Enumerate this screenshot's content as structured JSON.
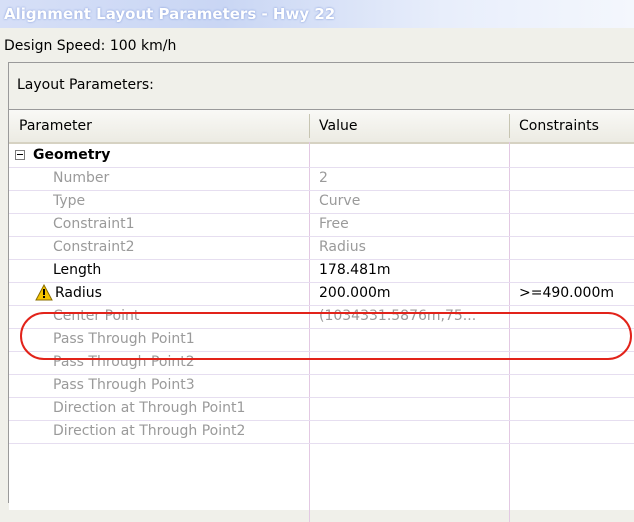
{
  "window": {
    "title": "Alignment Layout Parameters - Hwy 22"
  },
  "design_speed": "Design Speed: 100 km/h",
  "panel_title": "Layout Parameters:",
  "columns": [
    "Parameter",
    "Value",
    "Constraints"
  ],
  "group": {
    "label": "Geometry"
  },
  "rows": [
    {
      "parameter": "Number",
      "value": "2",
      "constraint": ""
    },
    {
      "parameter": "Type",
      "value": "Curve",
      "constraint": ""
    },
    {
      "parameter": "Constraint1",
      "value": "Free",
      "constraint": ""
    },
    {
      "parameter": "Constraint2",
      "value": "Radius",
      "constraint": ""
    },
    {
      "parameter": "Length",
      "value": "178.481m",
      "constraint": ""
    },
    {
      "parameter": "Radius",
      "value": "200.000m",
      "constraint": ">=490.000m"
    },
    {
      "parameter": "Center Point",
      "value": "(1034331.5876m,75...",
      "constraint": ""
    },
    {
      "parameter": "Pass Through Point1",
      "value": "",
      "constraint": ""
    },
    {
      "parameter": "Pass Through Point2",
      "value": "",
      "constraint": ""
    },
    {
      "parameter": "Pass Through Point3",
      "value": "",
      "constraint": ""
    },
    {
      "parameter": "Direction at Through Point1",
      "value": "",
      "constraint": ""
    },
    {
      "parameter": "Direction at Through Point2",
      "value": "",
      "constraint": ""
    }
  ],
  "colors": {
    "highlight": "#e2231a",
    "warning": "#f5c400",
    "muted_text": "#9a9a9a"
  },
  "icons": {
    "expander": "minus-box-icon",
    "warning": "warning-triangle-icon"
  }
}
